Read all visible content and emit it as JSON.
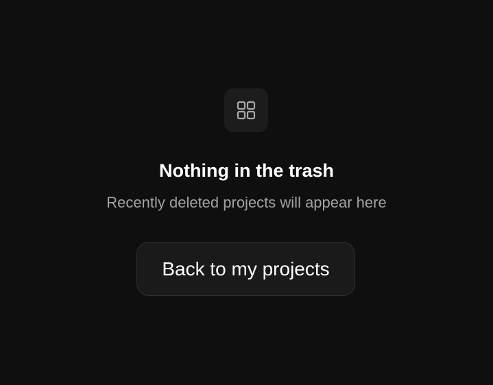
{
  "empty_state": {
    "icon": "grid-icon",
    "title": "Nothing in the trash",
    "subtitle": "Recently deleted projects will appear here",
    "button_label": "Back to my projects"
  },
  "colors": {
    "background": "#0f0f0f",
    "tile": "#1c1c1c",
    "button": "#1a1a1a",
    "button_border": "#2e2e2e",
    "title_text": "#ffffff",
    "subtitle_text": "#a3a3a3",
    "icon_stroke": "#a8a8a8"
  }
}
